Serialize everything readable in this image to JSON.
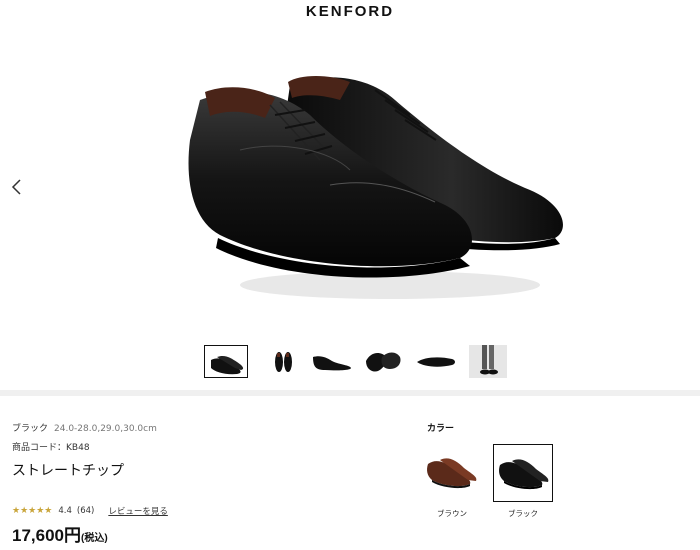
{
  "brand": "KENFORD",
  "gallery": {
    "prev_icon": "chevron-left-icon",
    "thumbnails": [
      "shoe-pair-angle",
      "shoe-pair-front",
      "shoe-side",
      "shoe-pair-top",
      "shoe-sole",
      "shoe-worn-model"
    ],
    "active_index": 0
  },
  "product": {
    "variant": "ブラック",
    "sizes": "24.0-28.0,29.0,30.0cm",
    "code_label": "商品コード：",
    "code": "KB48",
    "name": "ストレートチップ",
    "rating": {
      "value": 4.4,
      "display": "4.4",
      "count": "(64)",
      "stars": "★★★★★"
    },
    "review_link": "レビューを見る",
    "price": "17,600円",
    "tax_note": "(税込)"
  },
  "color": {
    "label": "カラー",
    "options": [
      {
        "name": "ブラウン",
        "hex": "#5b2a1a"
      },
      {
        "name": "ブラック",
        "hex": "#111111"
      }
    ],
    "selected": "ブラック"
  }
}
